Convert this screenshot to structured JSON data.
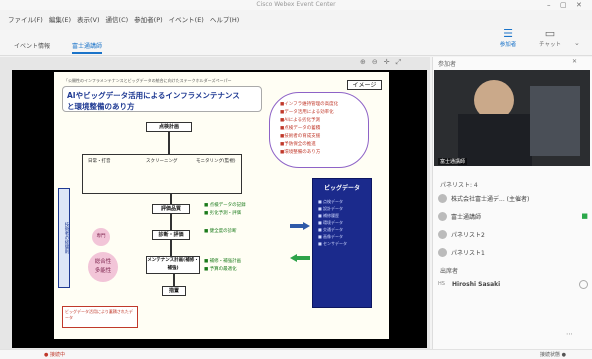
{
  "window": {
    "title": "Cisco Webex Event Center"
  },
  "menu": [
    "ファイル(F)",
    "編集(E)",
    "表示(V)",
    "通信(C)",
    "参加者(P)",
    "イベント(E)",
    "ヘルプ(H)"
  ],
  "tabs": [
    {
      "label": "イベント情報",
      "active": false
    },
    {
      "label": "富士通講師",
      "active": true
    }
  ],
  "toolbar": {
    "participants_label": "参加者",
    "chat_label": "チャット"
  },
  "panel": {
    "header": "参加者",
    "video_name": "富士通講師",
    "panelists_header": "パネリスト: 4",
    "panelists": [
      {
        "name": "株式会社富士通デ... (主催者)",
        "status": "presenting"
      },
      {
        "name": "富士通講師",
        "status": "active"
      },
      {
        "name": "パネリスト2",
        "status": ""
      },
      {
        "name": "パネリスト1",
        "status": ""
      }
    ],
    "attendees_header": "出席者",
    "attendees": [
      {
        "initials": "HS",
        "name": "Hiroshi Sasaki"
      }
    ]
  },
  "slide": {
    "header": "「公開性のインフラメンテナンスとビッグデータの統合に向けたステークホルダーズペーパー",
    "title_line1": "AIやビッグデータ活用によるインフラメンテナンス",
    "title_line2": "と環境整備のあり方",
    "badge": "イメージ",
    "big_data_label": "ビッグデータ",
    "flow": [
      "点検計画",
      "日常・打音",
      "スクリーニング",
      "モニタリング(監視)",
      "評価品質",
      "診断・評価",
      "メンテナンス計画(補修・補強)",
      "措置"
    ],
    "left_vertical": "技術者の経験則",
    "circle_labels": [
      "専門",
      "総合性",
      "多能性"
    ],
    "bottom_note": "ビッグデータ活用により蓄積されたデータ"
  },
  "status": {
    "left": "● 接続中",
    "right": "接続状態 ●"
  }
}
